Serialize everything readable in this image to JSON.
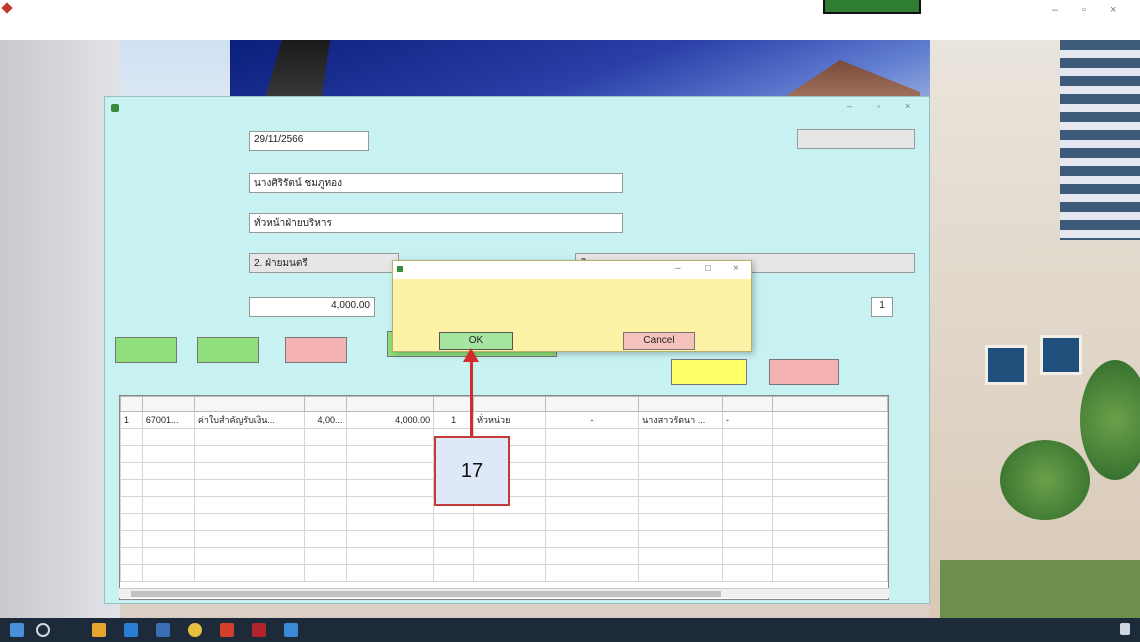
{
  "form": {
    "date_value": "29/11/2566",
    "recipient_value": "นางศิริรัตน์ ชมภูทอง",
    "position_value": "ทั่วหน้าฝ่ายบริหาร",
    "department_value": "2. ฝ่ายมนตรี",
    "amount_value": "4,000.00",
    "receipt_count_value": "1",
    "department_right_value": "ทิ"
  },
  "buttons": {
    "ok": "OK",
    "cancel": "Cancel"
  },
  "grid": {
    "rows": [
      [
        "1",
        "67001...",
        "ค่าใบสำคัญรับเงิน...",
        "4,00...",
        "4,000.00",
        "1",
        "ทั่วหน่วย",
        "-",
        "นางสาวรัตนา ...",
        "-"
      ]
    ]
  },
  "annotation": {
    "step_number": "17"
  },
  "colors": {
    "form_bg": "#c8f2f2",
    "dialog_bg": "#fdf2a6",
    "ok_button": "#a6e6a0",
    "cancel_button": "#f6c2bd",
    "arrow": "#d42a2a",
    "taskbar": "#1c2a3a"
  },
  "icons": {
    "app": "app-icon",
    "minimize": "minimize-icon",
    "maximize": "maximize-icon",
    "close": "close-icon",
    "start": "windows-start-icon",
    "search": "search-icon",
    "arrow": "arrow-up-icon"
  }
}
